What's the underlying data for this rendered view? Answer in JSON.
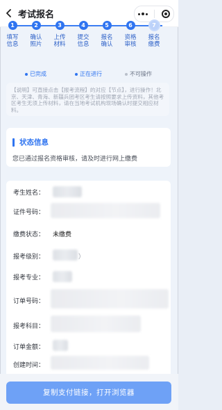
{
  "header": {
    "title": "考试报名",
    "back_icon": "chevron-left-icon",
    "more_icon": "more-dots-icon",
    "close_icon": "target-icon"
  },
  "steps": [
    {
      "num": "1",
      "label": "填写信息",
      "state": "done"
    },
    {
      "num": "2",
      "label": "确认照片",
      "state": "done"
    },
    {
      "num": "3",
      "label": "上传材料",
      "state": "done"
    },
    {
      "num": "4",
      "label": "提交信息",
      "state": "done"
    },
    {
      "num": "5",
      "label": "报名确认",
      "state": "done"
    },
    {
      "num": "6",
      "label": "资格审核",
      "state": "done"
    },
    {
      "num": "7",
      "label": "报名缴费",
      "state": "current"
    }
  ],
  "legend": {
    "done": "已完成",
    "current": "正在进行",
    "disabled": "不可操作",
    "colors": {
      "done": "#2f74f0",
      "current": "#2f74f0",
      "disabled": "#b9bfca"
    }
  },
  "note": "【说明】可直接点击【报考流程】的对应【节点】，进行操作！北京、天津、青海、新疆兵团考区考生请按照要求上传资料，其他考区考生无须上传材料，请在当地考试机构现场确认时提交相应材料。",
  "status": {
    "title": "状态信息",
    "description": "您已通过报名资格审核，请及时进行网上缴费"
  },
  "info": {
    "name_label": "考生姓名：",
    "id_label": "证件号码：",
    "pay_status_label": "缴费状态：",
    "pay_status_value": "未缴费",
    "level_label": "报考级别：",
    "level_visible_suffix": "）",
    "major_label": "报考专业：",
    "order_label": "订单号码：",
    "subject_label": "报考科目：",
    "amount_label": "订单金额：",
    "created_label": "创建时间："
  },
  "footer": {
    "button_label": "复制支付链接，打开浏览器"
  }
}
